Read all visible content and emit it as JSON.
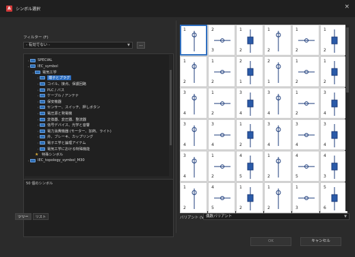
{
  "window": {
    "title": "シンボル選択",
    "app_icon": "A",
    "close_glyph": "×"
  },
  "filter": {
    "label": "フィルター (F)",
    "value": "- 有効でない -",
    "button_label": "..."
  },
  "tree": {
    "nodes": [
      {
        "label": "SPECIAL",
        "depth": 1,
        "toggle": "›",
        "type": "folder"
      },
      {
        "label": "IEC_symbol",
        "depth": 1,
        "toggle": "⌄",
        "type": "folder"
      },
      {
        "label": "電気工学",
        "depth": 2,
        "toggle": "⌄",
        "type": "folder"
      },
      {
        "label": "端子とプラグ",
        "depth": 3,
        "toggle": "›",
        "type": "folder",
        "selected": true
      },
      {
        "label": "コイル、接点、保護回路",
        "depth": 3,
        "toggle": "›",
        "type": "folder"
      },
      {
        "label": "PLC / バス",
        "depth": 3,
        "toggle": "›",
        "type": "folder"
      },
      {
        "label": "ケーブル / アンテナ",
        "depth": 3,
        "toggle": "›",
        "type": "folder"
      },
      {
        "label": "保安機器",
        "depth": 3,
        "toggle": "›",
        "type": "folder"
      },
      {
        "label": "センサー、スイッチ、押しボタン",
        "depth": 3,
        "toggle": "›",
        "type": "folder"
      },
      {
        "label": "電圧源と発電機",
        "depth": 3,
        "toggle": "›",
        "type": "folder"
      },
      {
        "label": "変換器、変圧器、整流器",
        "depth": 3,
        "toggle": "›",
        "type": "folder"
      },
      {
        "label": "信号デバイス、光学と音響",
        "depth": 3,
        "toggle": "›",
        "type": "folder"
      },
      {
        "label": "電力消費機器 (モーター、加熱、ライト)",
        "depth": 3,
        "toggle": "›",
        "type": "folder"
      },
      {
        "label": "弁、ブレーキ、カップリング",
        "depth": 3,
        "toggle": "›",
        "type": "folder"
      },
      {
        "label": "電子工学と論理アイテム",
        "depth": 3,
        "toggle": "›",
        "type": "folder"
      },
      {
        "label": "電気工学における特殊機能",
        "depth": 3,
        "toggle": "›",
        "type": "folder"
      },
      {
        "label": "特殊シンボル",
        "depth": 2,
        "toggle": "",
        "type": "favorite"
      },
      {
        "label": "IEC_topology_symbol_M30",
        "depth": 1,
        "toggle": "›",
        "type": "folder"
      }
    ]
  },
  "description": {
    "text": "50 個のシンボル"
  },
  "tabs": [
    {
      "label": "ツリー",
      "active": true
    },
    {
      "label": "リスト",
      "active": false
    }
  ],
  "variant": {
    "label": "バリアント (V)",
    "value": "偶数バリアント"
  },
  "buttons": {
    "ok": "OK",
    "cancel": "キャンセル"
  },
  "symbols": [
    {
      "n1": "1",
      "n2": ""
    },
    {
      "n1": "2",
      "n2": "3"
    },
    {
      "n1": "1",
      "n2": "2"
    },
    {
      "n1": "1",
      "n2": "2"
    },
    {
      "n1": "1",
      "n2": "2"
    },
    {
      "n1": "1",
      "n2": "2"
    },
    {
      "n1": "1",
      "n2": "2"
    },
    {
      "n1": "1",
      "n2": "2"
    },
    {
      "n1": "2",
      "n2": "1"
    },
    {
      "n1": "2",
      "n2": "1"
    },
    {
      "n1": "1",
      "n2": "2"
    },
    {
      "n1": "1",
      "n2": "2"
    },
    {
      "n1": "3",
      "n2": "4"
    },
    {
      "n1": "1",
      "n2": "2"
    },
    {
      "n1": "3",
      "n2": "4"
    },
    {
      "n1": "3",
      "n2": "4"
    },
    {
      "n1": "1",
      "n2": "2"
    },
    {
      "n1": "3",
      "n2": "4"
    },
    {
      "n1": "3",
      "n2": "4"
    },
    {
      "n1": "3",
      "n2": "4"
    },
    {
      "n1": "1",
      "n2": "2"
    },
    {
      "n1": "3",
      "n2": "4"
    },
    {
      "n1": "3",
      "n2": "4"
    },
    {
      "n1": "3",
      "n2": "4"
    },
    {
      "n1": "3",
      "n2": "4"
    },
    {
      "n1": "1",
      "n2": "2"
    },
    {
      "n1": "4",
      "n2": "5"
    },
    {
      "n1": "1",
      "n2": "2"
    },
    {
      "n1": "4",
      "n2": "5"
    },
    {
      "n1": "4",
      "n2": "3"
    },
    {
      "n1": "1",
      "n2": "2"
    },
    {
      "n1": "4",
      "n2": "5"
    },
    {
      "n1": "1",
      "n2": "2"
    },
    {
      "n1": "1",
      "n2": "2"
    },
    {
      "n1": "1",
      "n2": "3"
    },
    {
      "n1": "5",
      "n2": "6"
    }
  ]
}
